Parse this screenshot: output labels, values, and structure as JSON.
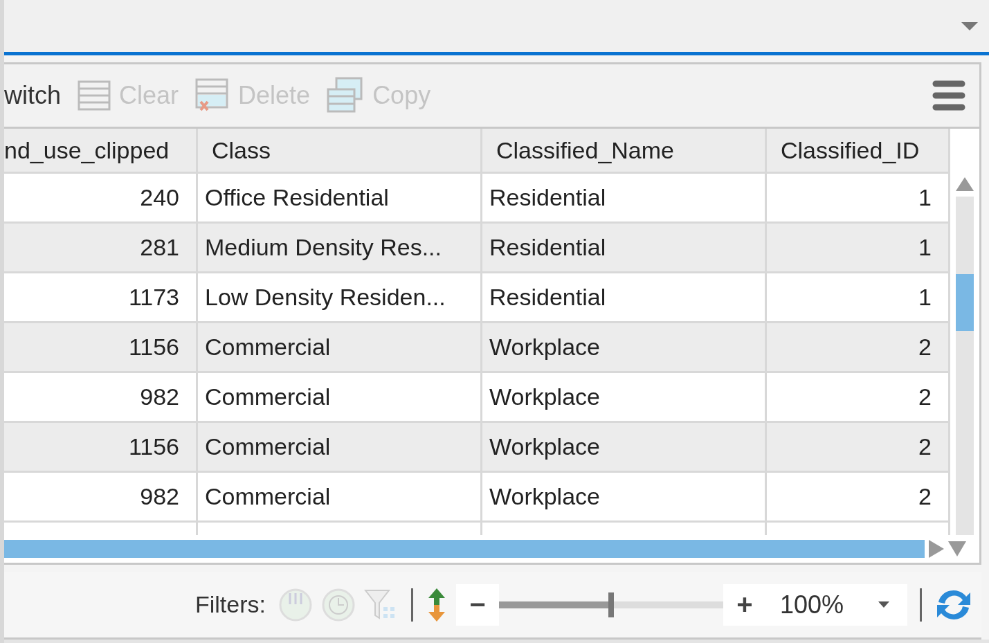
{
  "toolbar": {
    "buttons": [
      {
        "label": "witch",
        "disabled": false
      },
      {
        "label": "Clear",
        "disabled": true
      },
      {
        "label": "Delete",
        "disabled": true
      },
      {
        "label": "Copy",
        "disabled": true
      }
    ]
  },
  "table": {
    "columns": [
      "nd_use_clipped",
      "Class",
      "Classified_Name",
      "Classified_ID"
    ],
    "rows": [
      [
        "240",
        "Office Residential",
        "Residential",
        "1"
      ],
      [
        "281",
        "Medium Density Res...",
        "Residential",
        "1"
      ],
      [
        "1173",
        "Low Density Residen...",
        "Residential",
        "1"
      ],
      [
        "1156",
        "Commercial",
        "Workplace",
        "2"
      ],
      [
        "982",
        "Commercial",
        "Workplace",
        "2"
      ],
      [
        "1156",
        "Commercial",
        "Workplace",
        "2"
      ],
      [
        "982",
        "Commercial",
        "Workplace",
        "2"
      ]
    ]
  },
  "status_bar": {
    "filters_label": "Filters:",
    "zoom": {
      "minus": "−",
      "plus": "+",
      "level": 0.5,
      "value": "100%"
    }
  }
}
